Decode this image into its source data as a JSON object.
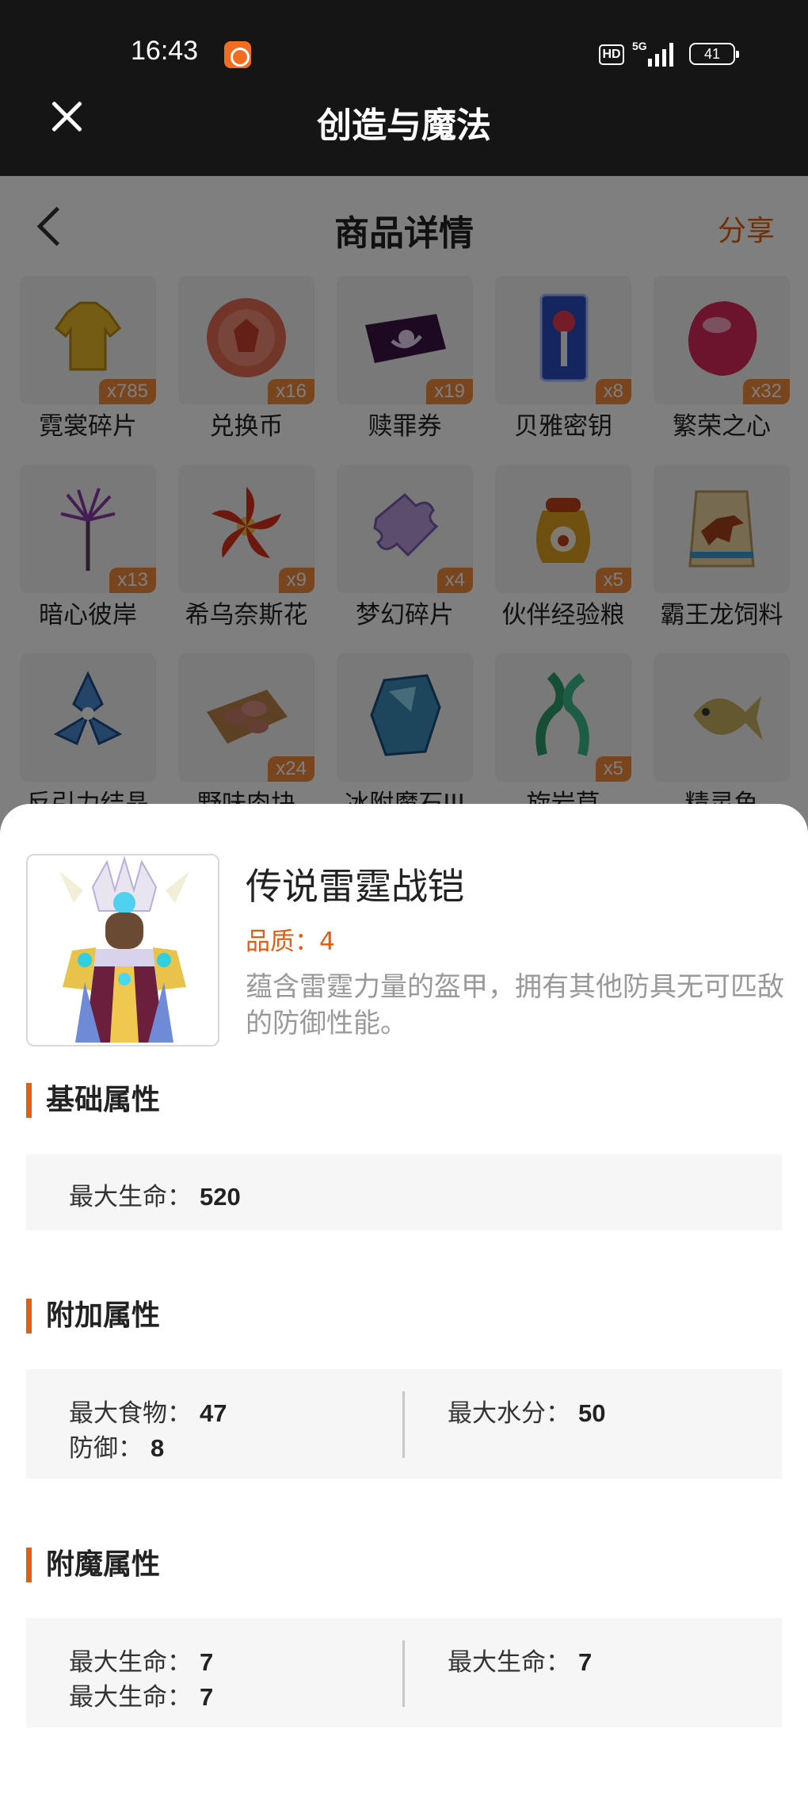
{
  "status_bar": {
    "time": "16:43",
    "hd": "HD",
    "network": "5G",
    "battery": "41"
  },
  "app_bar": {
    "title": "创造与魔法"
  },
  "page": {
    "title": "商品详情",
    "share_label": "分享"
  },
  "items": [
    {
      "name": "霓裳碎片",
      "qty": "x785",
      "icon": "golden-shirt-icon"
    },
    {
      "name": "兑换币",
      "qty": "x16",
      "icon": "red-coin-icon"
    },
    {
      "name": "赎罪券",
      "qty": "x19",
      "icon": "purple-ticket-icon"
    },
    {
      "name": "贝雅密钥",
      "qty": "x8",
      "icon": "key-card-icon"
    },
    {
      "name": "繁荣之心",
      "qty": "x32",
      "icon": "pink-gem-icon"
    },
    {
      "name": "暗心彼岸",
      "qty": "x13",
      "icon": "purple-flower-icon"
    },
    {
      "name": "希乌奈斯花",
      "qty": "x9",
      "icon": "red-flower-icon"
    },
    {
      "name": "梦幻碎片",
      "qty": "x4",
      "icon": "puzzle-piece-icon"
    },
    {
      "name": "伙伴经验粮",
      "qty": "x5",
      "icon": "food-sack-icon"
    },
    {
      "name": "霸王龙饲料",
      "qty": "",
      "icon": "dino-feed-bag-icon"
    },
    {
      "name": "反引力结晶",
      "qty": "",
      "icon": "crystal-emblem-icon"
    },
    {
      "name": "野味肉块",
      "qty": "x24",
      "icon": "meat-tray-icon"
    },
    {
      "name": "冰附魔石III",
      "qty": "",
      "icon": "ice-stone-icon"
    },
    {
      "name": "旋岩草",
      "qty": "x5",
      "icon": "green-vine-icon"
    },
    {
      "name": "精灵鱼",
      "qty": "",
      "icon": "spirit-fish-icon"
    }
  ],
  "detail": {
    "name": "传说雷霆战铠",
    "quality": "品质：4",
    "description": "蕴含雷霆力量的盔甲，拥有其他防具无可匹敌的防御性能。",
    "image_icon": "thunder-armor-figure-icon"
  },
  "sections": {
    "basic": {
      "title": "基础属性",
      "attrs": [
        {
          "label": "最大生命：",
          "value": "520"
        }
      ]
    },
    "extra": {
      "title": "附加属性",
      "left": [
        {
          "label": "最大食物：",
          "value": "47"
        },
        {
          "label": "防御：",
          "value": "8"
        }
      ],
      "right": [
        {
          "label": "最大水分：",
          "value": "50"
        }
      ]
    },
    "enchant": {
      "title": "附魔属性",
      "left": [
        {
          "label": "最大生命：",
          "value": "7"
        },
        {
          "label": "最大生命：",
          "value": "7"
        }
      ],
      "right": [
        {
          "label": "最大生命：",
          "value": "7"
        }
      ]
    }
  },
  "colors": {
    "accent": "#e0600f",
    "badge": "#f08a3e",
    "overlay": "rgba(0,0,0,0.5)"
  }
}
